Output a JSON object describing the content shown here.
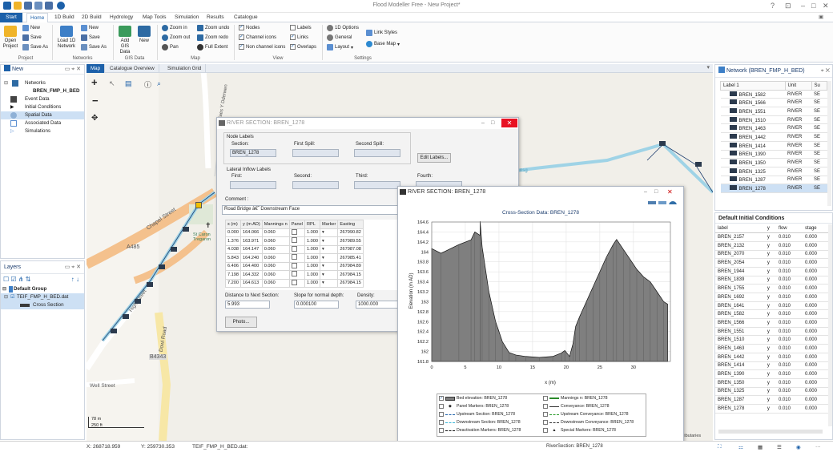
{
  "app": {
    "title": "Flood Modeller Free - New Project*"
  },
  "ribbon": {
    "tabs": [
      "Start",
      "Home",
      "1D Build",
      "2D Build",
      "Hydrology",
      "Map Tools",
      "Simulation",
      "Results",
      "Catalogue"
    ],
    "project": {
      "open": "Open Project",
      "new": "New",
      "save": "Save",
      "save_as": "Save As",
      "group": "Project"
    },
    "networks": {
      "load": "Load 1D Network",
      "new": "New",
      "save": "Save",
      "save_as": "Save As",
      "group": "Networks"
    },
    "gis": {
      "add": "Add GIS Data",
      "new": "New",
      "group": "GIS Data"
    },
    "map": {
      "zoom_in": "Zoom in",
      "zoom_out": "Zoom out",
      "pan": "Pan",
      "zoom_undo": "Zoom undo",
      "zoom_redo": "Zoom redo",
      "full_extent": "Full Extent",
      "group": "Map"
    },
    "view": {
      "nodes": "Nodes",
      "channel_icons": "Channel icons",
      "non_channel_icons": "Non channel icons",
      "labels": "Labels",
      "links": "Links",
      "overlaps": "Overlaps",
      "group": "View"
    },
    "settings": {
      "options_1d": "1D Options",
      "general": "General",
      "layout": "Layout",
      "link_styles": "Link Styles",
      "base_map": "Base Map",
      "group": "Settings"
    }
  },
  "new_panel": {
    "title": "New",
    "items": [
      "Networks",
      "BREN_FMP_H_BED",
      "Event Data",
      "Initial Conditions",
      "Spatial Data",
      "Associated Data",
      "Simulations"
    ]
  },
  "layers_panel": {
    "title": "Layers",
    "items": [
      "Default Group",
      "TEIF_FMP_H_BED.dat",
      "Cross Section"
    ]
  },
  "map_tabs": [
    "Map",
    "Catalogue Overview",
    "Simulation Grid"
  ],
  "map_labels": [
    "Chapel Street",
    "A485",
    "High Street",
    "Dowl Road",
    "B4343",
    "Well Street",
    "St Caron Tregaron",
    "Maes Y Dderwen",
    "nsg",
    "tributaries"
  ],
  "scale": {
    "meters": "78 m",
    "feet": "250 ft"
  },
  "river_dialog": {
    "title": "RIVER SECTION: BREN_1278",
    "node_labels": "Node Labels",
    "section_label": "Section:",
    "section_value": "BREN_1278",
    "first_spill": "First Spill:",
    "second_spill": "Second Spill:",
    "edit_labels": "Edit Labels...",
    "lateral_labels": "Lateral Inflow Labels",
    "first": "First:",
    "second": "Second:",
    "third": "Third:",
    "fourth": "Fourth:",
    "comment_label": "Comment :",
    "comment_value": "Road Bridge â€˜ Downstream Face",
    "columns": [
      "x (m)",
      "y (m AD)",
      "Mannings n",
      "Panel",
      "RPL",
      "Marker",
      "Easting"
    ],
    "rows": [
      [
        "0.000",
        "164.066",
        "0.060",
        "1.000",
        "267990.82"
      ],
      [
        "1.376",
        "163.971",
        "0.060",
        "1.000",
        "267989.55"
      ],
      [
        "4.038",
        "164.147",
        "0.060",
        "1.000",
        "267987.08"
      ],
      [
        "5.843",
        "164.240",
        "0.060",
        "1.000",
        "267985.41"
      ],
      [
        "6.406",
        "164.400",
        "0.060",
        "1.000",
        "267984.89"
      ],
      [
        "7.198",
        "164.332",
        "0.060",
        "1.000",
        "267984.15"
      ],
      [
        "7.200",
        "164.613",
        "0.060",
        "1.000",
        "267984.15"
      ]
    ],
    "distance_label": "Distance to Next Section:",
    "distance_value": "5.993",
    "slope_label": "Slope for normal depth:",
    "slope_value": "0.000100",
    "density_label": "Density:",
    "density_value": "1000.000",
    "photo": "Photo..."
  },
  "xs_dialog": {
    "title": "RIVER SECTION: BREN_1278",
    "legend": [
      {
        "label": "Bed elevation: BREN_1278",
        "checked": true
      },
      {
        "label": "Mannings n: BREN_1278",
        "checked": false
      },
      {
        "label": "Panel Markers: BREN_1278",
        "checked": false
      },
      {
        "label": "Conveyance: BREN_1278",
        "checked": false
      },
      {
        "label": "Upstream Section: BREN_1278",
        "checked": false
      },
      {
        "label": "Upstream Conveyance: BREN_1278",
        "checked": false
      },
      {
        "label": "Downstream Section: BREN_1278",
        "checked": false
      },
      {
        "label": "Downstream Conveyance: BREN_1278",
        "checked": false
      },
      {
        "label": "Deactivation Markers: BREN_1278",
        "checked": false
      },
      {
        "label": "Special Markers: BREN_1278",
        "checked": false
      }
    ]
  },
  "chart_data": {
    "type": "area",
    "title": "Cross-Section Data: BREN_1278",
    "xlabel": "x (m)",
    "ylabel": "Elevation (m AD)",
    "xlim": [
      0,
      35.5
    ],
    "ylim": [
      161.8,
      164.6
    ],
    "x_ticks": [
      0,
      5,
      10,
      15,
      20,
      25,
      30
    ],
    "y_ticks": [
      161.8,
      162,
      162.2,
      162.4,
      162.6,
      162.8,
      163,
      163.2,
      163.4,
      163.6,
      163.8,
      164,
      164.2,
      164.4,
      164.6
    ],
    "grid": true,
    "series": [
      {
        "name": "Bed elevation: BREN_1278",
        "x": [
          0,
          1.376,
          4.038,
          5.843,
          6.406,
          7.198,
          7.2,
          7.5,
          8.5,
          9.5,
          10.5,
          11.5,
          12.5,
          14,
          16,
          18,
          19.3,
          19.8,
          20.5,
          21,
          21.4,
          22,
          23,
          24,
          25,
          26,
          27,
          27.5,
          28.5,
          29.5,
          30.5,
          31.5,
          32.5,
          33.5,
          34.5,
          35.1
        ],
        "y": [
          164.066,
          163.971,
          164.147,
          164.24,
          164.4,
          164.332,
          164.613,
          164.1,
          163.2,
          162.6,
          162.2,
          161.98,
          161.93,
          161.9,
          161.88,
          161.9,
          161.97,
          162.02,
          161.9,
          162.15,
          162.5,
          162.7,
          163.0,
          163.3,
          163.6,
          163.9,
          164.15,
          164.25,
          164.05,
          163.85,
          163.65,
          163.5,
          163.4,
          163.2,
          163.0,
          162.95
        ]
      }
    ],
    "legend_position": "bottom"
  },
  "network_panel": {
    "title": "Network (BREN_FMP_H_BED)",
    "columns": [
      "Label 1",
      "Unit",
      "Su"
    ],
    "rows": [
      [
        "BREN_1582",
        "RIVER",
        "SE"
      ],
      [
        "BREN_1566",
        "RIVER",
        "SE"
      ],
      [
        "BREN_1551",
        "RIVER",
        "SE"
      ],
      [
        "BREN_1510",
        "RIVER",
        "SE"
      ],
      [
        "BREN_1463",
        "RIVER",
        "SE"
      ],
      [
        "BREN_1442",
        "RIVER",
        "SE"
      ],
      [
        "BREN_1414",
        "RIVER",
        "SE"
      ],
      [
        "BREN_1390",
        "RIVER",
        "SE"
      ],
      [
        "BREN_1350",
        "RIVER",
        "SE"
      ],
      [
        "BREN_1325",
        "RIVER",
        "SE"
      ],
      [
        "BREN_1287",
        "RIVER",
        "SE"
      ],
      [
        "BREN_1278",
        "RIVER",
        "SE"
      ]
    ],
    "selected": "BREN_1278"
  },
  "ic_panel": {
    "title": "Default Initial Conditions",
    "columns": [
      "label",
      "y",
      "flow",
      "stage"
    ],
    "rows": [
      [
        "BREN_2157",
        "y",
        "0.010",
        "0.000"
      ],
      [
        "BREN_2132",
        "y",
        "0.010",
        "0.000"
      ],
      [
        "BREN_2070",
        "y",
        "0.010",
        "0.000"
      ],
      [
        "BREN_2054",
        "y",
        "0.010",
        "0.000"
      ],
      [
        "BREN_1944",
        "y",
        "0.010",
        "0.000"
      ],
      [
        "BREN_1839",
        "y",
        "0.010",
        "0.000"
      ],
      [
        "BREN_1755",
        "y",
        "0.010",
        "0.000"
      ],
      [
        "BREN_1692",
        "y",
        "0.010",
        "0.000"
      ],
      [
        "BREN_1641",
        "y",
        "0.010",
        "0.000"
      ],
      [
        "BREN_1582",
        "y",
        "0.010",
        "0.000"
      ],
      [
        "BREN_1566",
        "y",
        "0.010",
        "0.000"
      ],
      [
        "BREN_1551",
        "y",
        "0.010",
        "0.000"
      ],
      [
        "BREN_1510",
        "y",
        "0.010",
        "0.000"
      ],
      [
        "BREN_1463",
        "y",
        "0.010",
        "0.000"
      ],
      [
        "BREN_1442",
        "y",
        "0.010",
        "0.000"
      ],
      [
        "BREN_1414",
        "y",
        "0.010",
        "0.000"
      ],
      [
        "BREN_1390",
        "y",
        "0.010",
        "0.000"
      ],
      [
        "BREN_1350",
        "y",
        "0.010",
        "0.000"
      ],
      [
        "BREN_1325",
        "y",
        "0.010",
        "0.000"
      ],
      [
        "BREN_1287",
        "y",
        "0.010",
        "0.000"
      ],
      [
        "BREN_1278",
        "y",
        "0.010",
        "0.000"
      ]
    ]
  },
  "status": {
    "x": "X: 268718.959",
    "y": "Y: 259730.353",
    "file": "TEIF_FMP_H_BED.dat:",
    "section": "RiverSection: BREN_1278"
  },
  "colors": {
    "accent": "#1c60a9",
    "river": "#9fd3e6",
    "road_orange": "#f4c18d",
    "bed_fill": "#7f7f7f"
  }
}
